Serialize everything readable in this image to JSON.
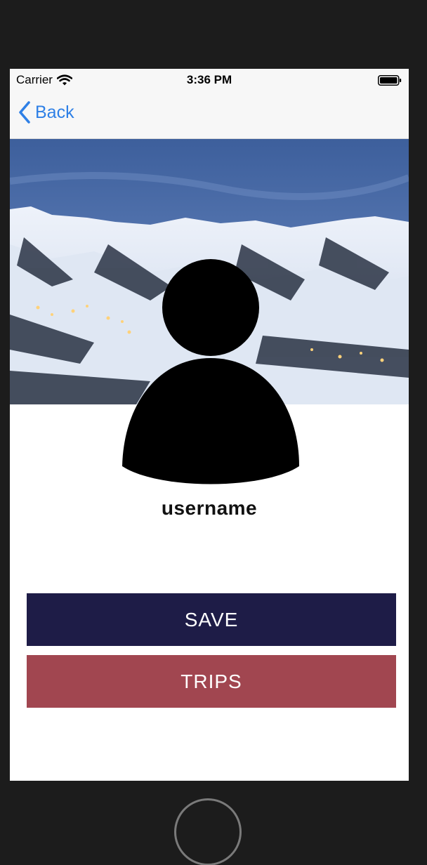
{
  "status_bar": {
    "carrier": "Carrier",
    "time": "3:36 PM",
    "wifi_icon": "wifi-icon",
    "battery_icon": "battery-icon"
  },
  "nav": {
    "back_label": "Back",
    "back_icon": "chevron-left-icon",
    "accent_color": "#2f80e6"
  },
  "hero": {
    "image": "snowy-mountain-landscape"
  },
  "profile": {
    "avatar_icon": "user-silhouette-icon",
    "username": "username"
  },
  "actions": {
    "save_label": "SAVE",
    "save_color": "#1e1c47",
    "trips_label": "TRIPS",
    "trips_color": "#a14650"
  },
  "device": {
    "home_button_icon": "home-button-icon"
  }
}
